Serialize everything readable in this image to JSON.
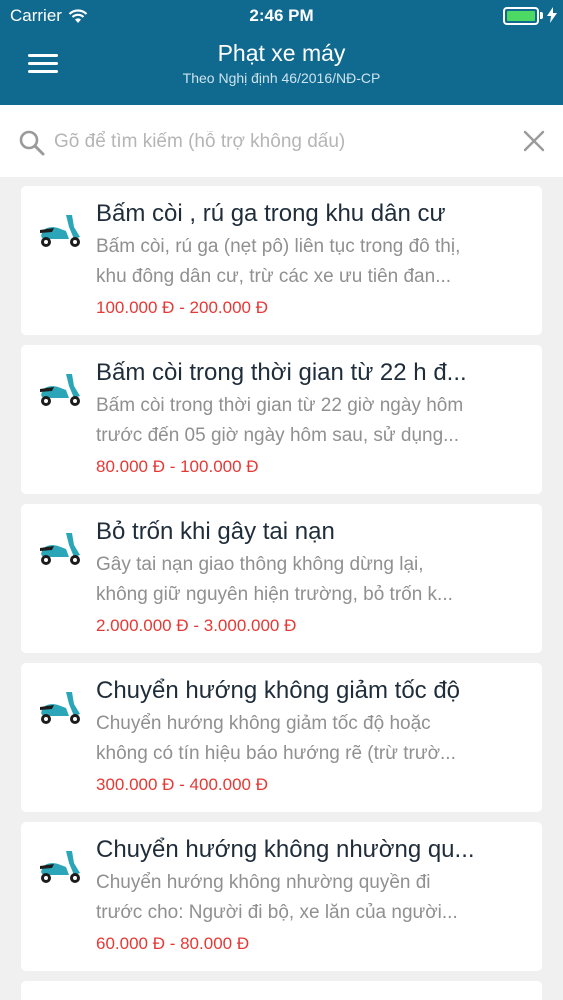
{
  "status_bar": {
    "carrier": "Carrier",
    "time": "2:46 PM"
  },
  "header": {
    "title": "Phạt xe máy",
    "subtitle": "Theo Nghị định 46/2016/NĐ-CP",
    "menu_icon": "hamburger-menu-icon"
  },
  "search": {
    "placeholder": "Gõ để tìm kiếm (hỗ trợ không dấu)",
    "value": "",
    "icon": "search-icon",
    "clear_icon": "close-icon"
  },
  "items": [
    {
      "title": "Bấm còi , rú ga trong khu dân cư",
      "desc1": "Bấm còi, rú ga (nẹt pô) liên tục trong đô thị,",
      "desc2": "khu đông dân cư, trừ các xe ưu tiên đan...",
      "price": "100.000 Đ - 200.000 Đ"
    },
    {
      "title": "Bấm còi trong thời gian từ 22 h đ...",
      "desc1": "Bấm còi trong thời gian từ 22 giờ ngày hôm",
      "desc2": "trước đến 05 giờ ngày hôm sau, sử dụng...",
      "price": "80.000 Đ - 100.000 Đ"
    },
    {
      "title": "Bỏ trốn khi gây tai nạn",
      "desc1": "Gây tai nạn giao thông không dừng lại,",
      "desc2": "không giữ nguyên hiện trường, bỏ trốn k...",
      "price": "2.000.000 Đ - 3.000.000 Đ"
    },
    {
      "title": "Chuyển hướng không giảm tốc độ",
      "desc1": "Chuyển hướng không giảm tốc độ hoặc",
      "desc2": "không có tín hiệu báo hướng rẽ (trừ trườ...",
      "price": "300.000 Đ - 400.000 Đ"
    },
    {
      "title": "Chuyển hướng không nhường qu...",
      "desc1": "Chuyển hướng không nhường quyền đi",
      "desc2": "trước cho: Người đi bộ, xe lăn của người...",
      "price": "60.000 Đ - 80.000 Đ"
    }
  ],
  "colors": {
    "header": "#106a8f",
    "price": "#e53935",
    "icon": "#2aa6b8"
  }
}
